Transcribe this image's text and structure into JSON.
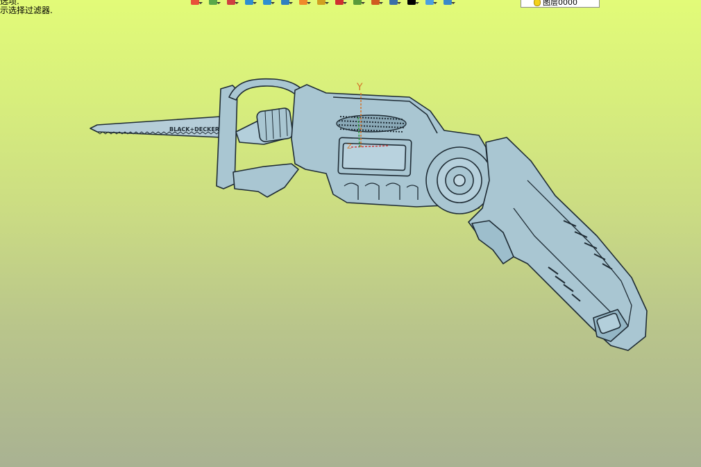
{
  "status": {
    "line1": "选项.",
    "line2": "示选择过滤器."
  },
  "toolbar": {
    "buttons": [
      {
        "name": "new-icon",
        "color": "#e8503a"
      },
      {
        "name": "layers-icon",
        "color": "#5aa84a"
      },
      {
        "name": "sketch-icon",
        "color": "#d04040"
      },
      {
        "name": "solid-icon",
        "color": "#2f8fd0"
      },
      {
        "name": "surface-icon",
        "color": "#2f8fd0"
      },
      {
        "name": "cube-icon",
        "color": "#2f7fc0"
      },
      {
        "name": "color-palette-icon",
        "color": "#f08a2a"
      },
      {
        "name": "image-icon",
        "color": "#d0a020"
      },
      {
        "name": "snap-icon",
        "color": "#d03030"
      },
      {
        "name": "document-icon",
        "color": "#5a9a3a"
      },
      {
        "name": "analysis-icon",
        "color": "#d05a20"
      },
      {
        "name": "render-icon",
        "color": "#3a70a8"
      },
      {
        "name": "color-swatch-icon",
        "color": "#000000"
      },
      {
        "name": "wireframe-icon",
        "color": "#4aa0e0"
      },
      {
        "name": "view-icon",
        "color": "#3a8ac8"
      }
    ],
    "layer_label": "图层0000"
  },
  "axis": {
    "y_label": "Y",
    "z_label": "Z"
  },
  "model": {
    "blade_text": "BLACK+DECKER"
  },
  "colors": {
    "model_fill": "#a9c6d2",
    "model_dark": "#7fa2b2",
    "model_edge": "#1e2b34",
    "axis_y": "#d4742a",
    "axis_x": "#d03a3a",
    "axis_z": "#2e9a3e"
  }
}
